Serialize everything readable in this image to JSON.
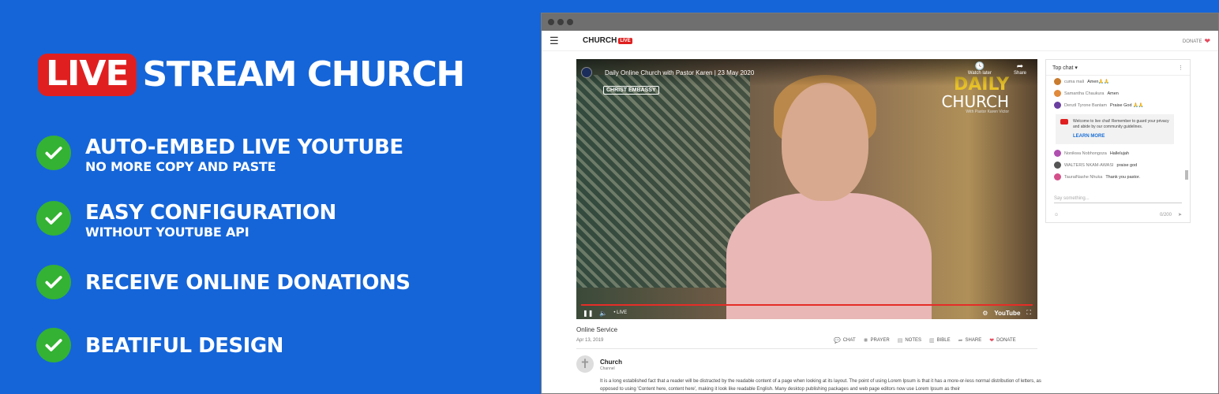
{
  "promo": {
    "live_badge": "LIVE",
    "headline": "STREAM CHURCH",
    "features": [
      {
        "title": "AUTO-EMBED LIVE YOUTUBE",
        "subtitle": "NO MORE COPY AND PASTE"
      },
      {
        "title": "EASY CONFIGURATION",
        "subtitle": "WITHOUT YOUTUBE API"
      },
      {
        "title": "RECEIVE ONLINE DONATIONS",
        "subtitle": ""
      },
      {
        "title": "BEATIFUL DESIGN",
        "subtitle": ""
      }
    ]
  },
  "site": {
    "logo_text": "CHURCH",
    "logo_badge": "LIVE",
    "donate_link": "DONATE"
  },
  "video": {
    "title": "Daily Online Church with Pastor Karen | 23 May 2020",
    "watch_later": "Watch later",
    "share": "Share",
    "live_label": "• LIVE",
    "youtube_label": "YouTube",
    "overlay_daily": "DAILY",
    "overlay_church": "CHURCH",
    "overlay_with": "With Pastor Karen Victor",
    "overlay_christ": "CHRIST EMBASSY"
  },
  "below_video": {
    "title": "Online Service",
    "date": "Apr 13, 2019",
    "actions": [
      "CHAT",
      "PRAYER",
      "NOTES",
      "BIBLE",
      "SHARE",
      "DONATE"
    ],
    "channel_name": "Church",
    "channel_sub": "Channel",
    "description": "It is a long established fact that a reader will be distracted by the readable content of a page when looking at its layout. The point of using Lorem Ipsum is that it has a more-or-less normal distribution of letters, as opposed to using 'Content here, content here', making it look like readable English. Many desktop publishing packages and web page editors now use Lorem Ipsum as their"
  },
  "chat": {
    "header": "Top chat ▾",
    "messages_top": [
      {
        "author": "cuma mali",
        "text": "Amen🙏🙏",
        "color": "#c97b2e"
      },
      {
        "author": "Samantha Chaukura",
        "text": "Amen",
        "color": "#e08a3a"
      },
      {
        "author": "Denzil Tyrone Bantam",
        "text": "Praise God 🙏🙏",
        "color": "#6a3fa0"
      }
    ],
    "notice": "Welcome to live chat! Remember to guard your privacy and abide by our community guidelines.",
    "notice_link": "LEARN MORE",
    "messages_bottom": [
      {
        "author": "Nonikwa Nobhongoza",
        "text": "Hallelujah",
        "color": "#b04fb0"
      },
      {
        "author": "WALTERS NKAM-AWASI",
        "text": "praise god",
        "color": "#555555"
      },
      {
        "author": "TauraiNashe Nhuka",
        "text": "Thank you pastor.",
        "color": "#d4508a"
      }
    ],
    "input_placeholder": "Say something...",
    "char_count": "0/200"
  },
  "colors": {
    "background": "#1565d8",
    "live_red": "#e02020",
    "check_green": "#34b233"
  }
}
